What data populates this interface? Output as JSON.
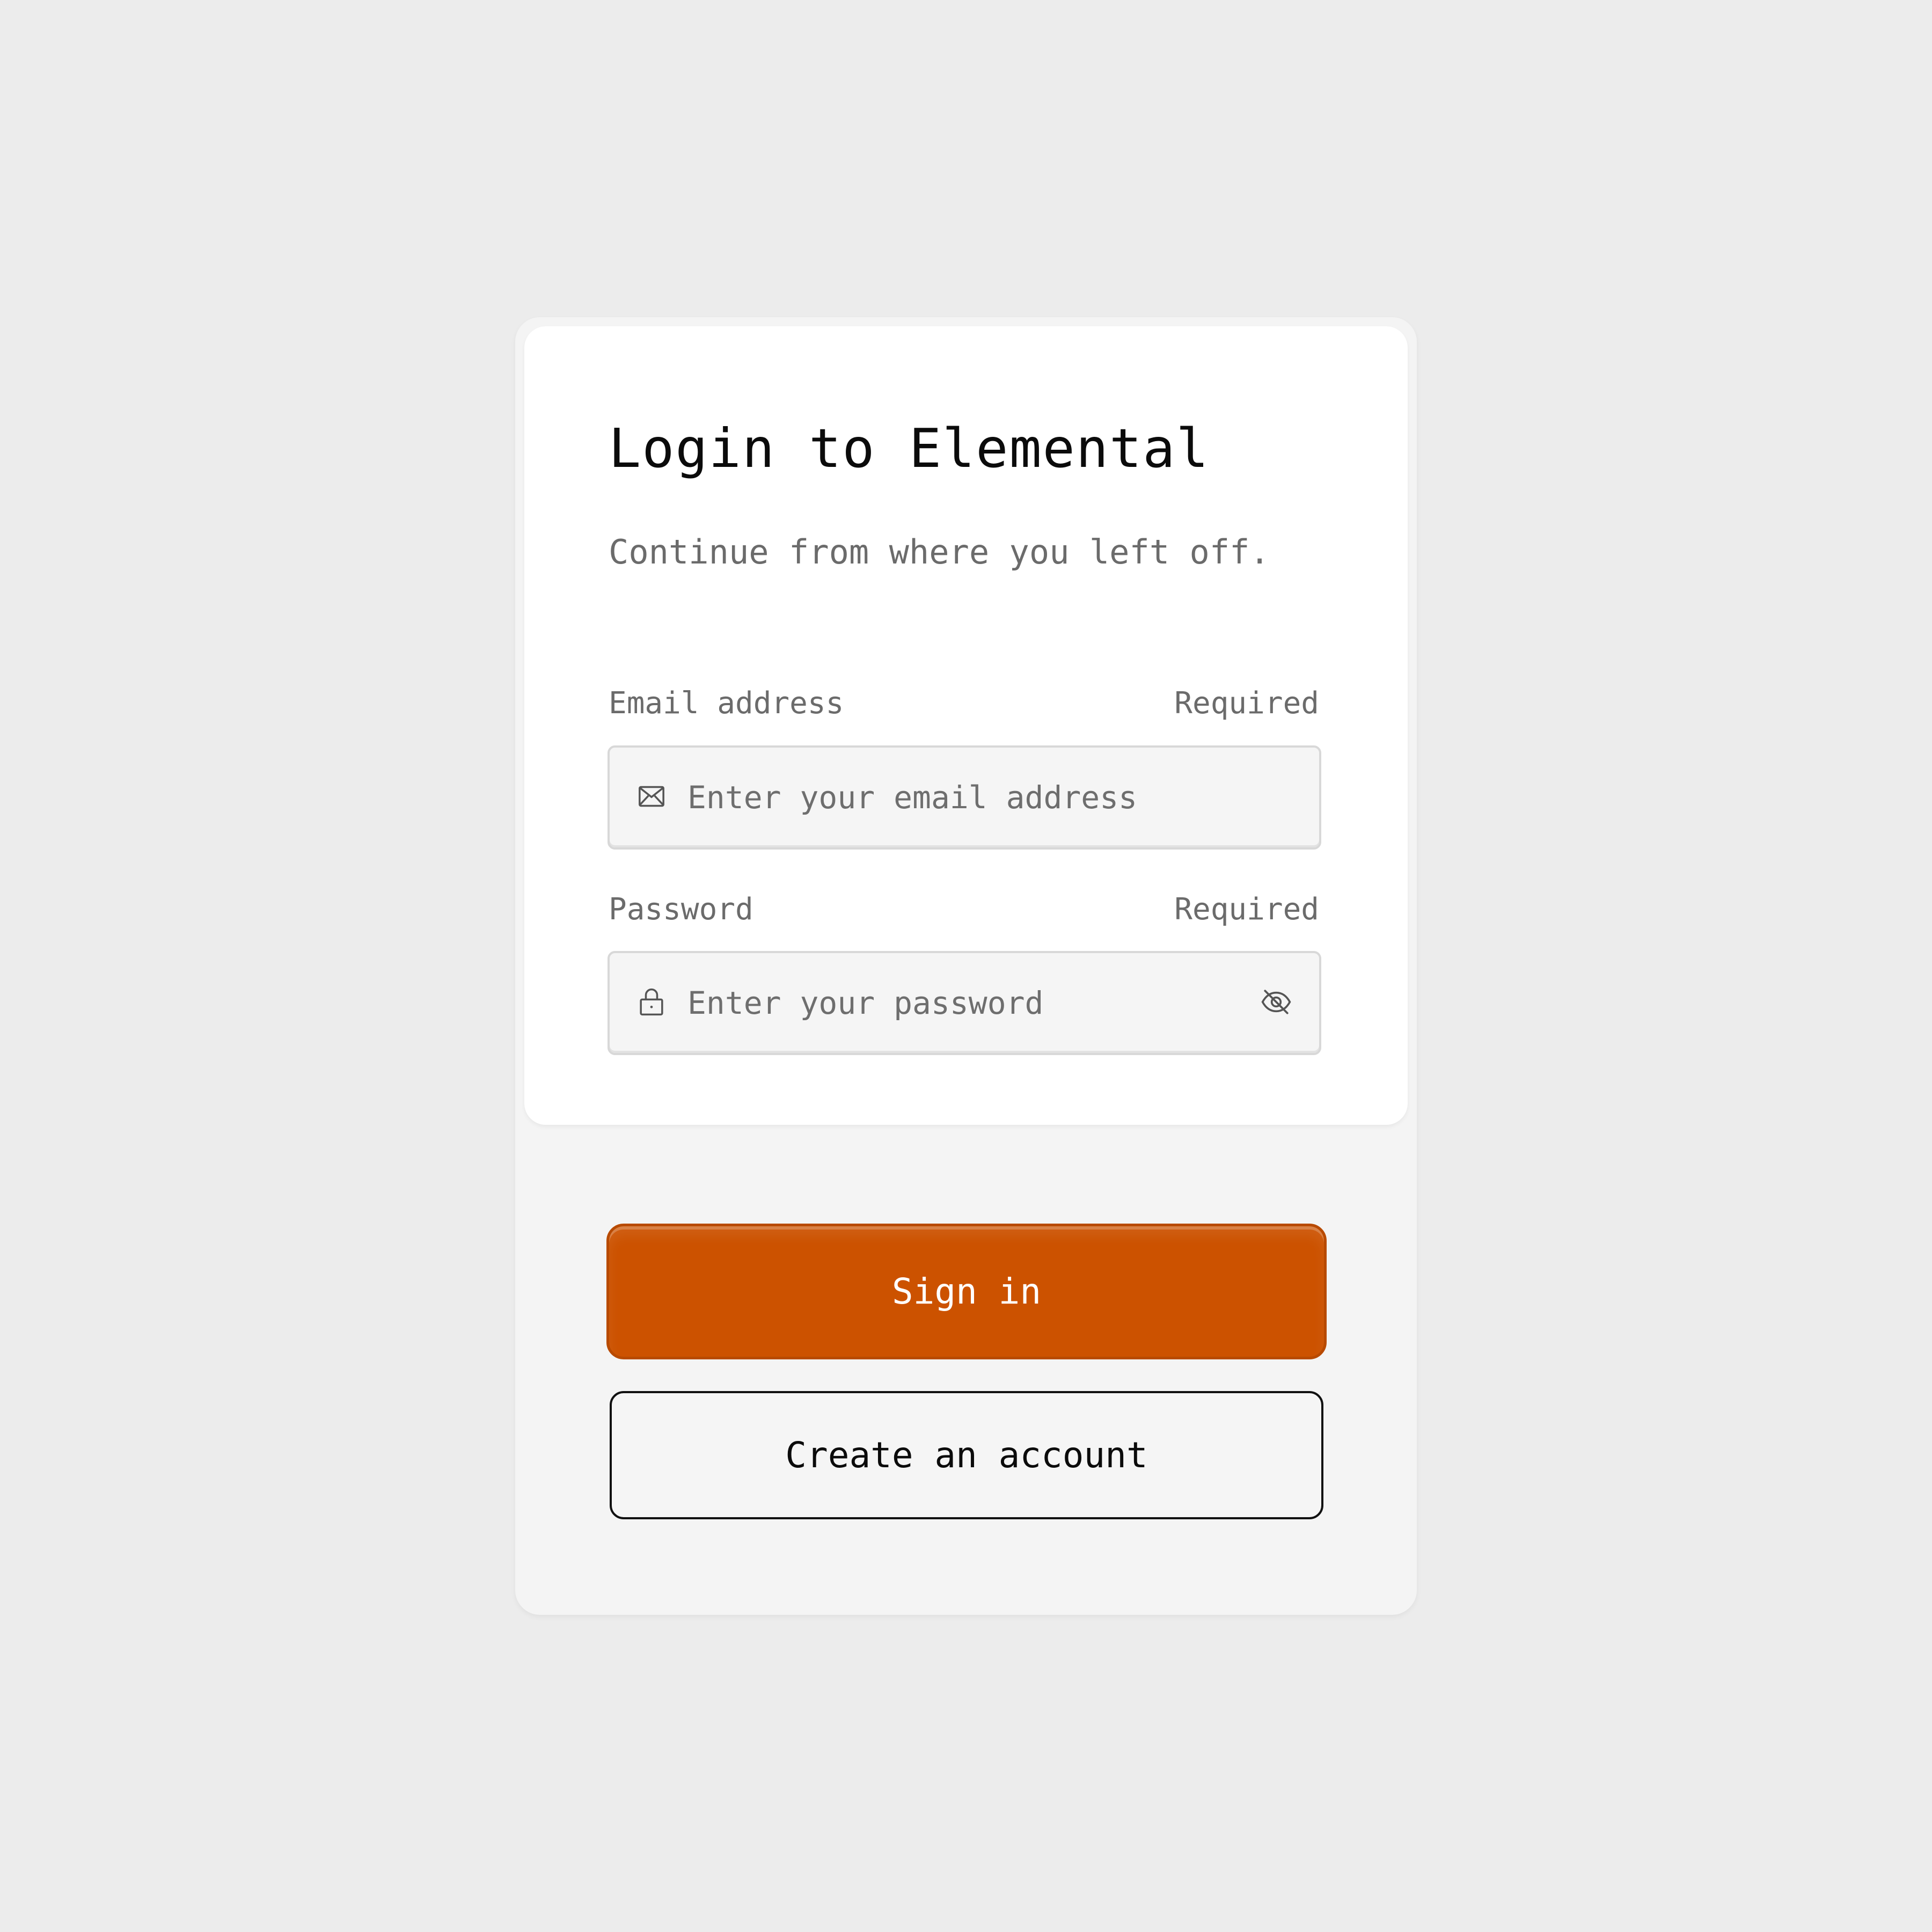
{
  "login": {
    "title": "Login to Elemental",
    "subtitle": "Continue from where you left off.",
    "email": {
      "label": "Email address",
      "required": "Required",
      "placeholder": "Enter your email address",
      "icon": "mail-icon"
    },
    "password": {
      "label": "Password",
      "required": "Required",
      "placeholder": "Enter your password",
      "icon": "lock-icon",
      "toggle_icon": "eye-off-icon"
    },
    "sign_in_label": "Sign in",
    "create_account_label": "Create an account"
  },
  "colors": {
    "page_background": "#ececec",
    "card_background": "#f4f4f4",
    "panel_background": "#ffffff",
    "primary_button": "#cc5200",
    "text_primary": "#0b0b0b",
    "text_muted": "#6b6b6b"
  }
}
